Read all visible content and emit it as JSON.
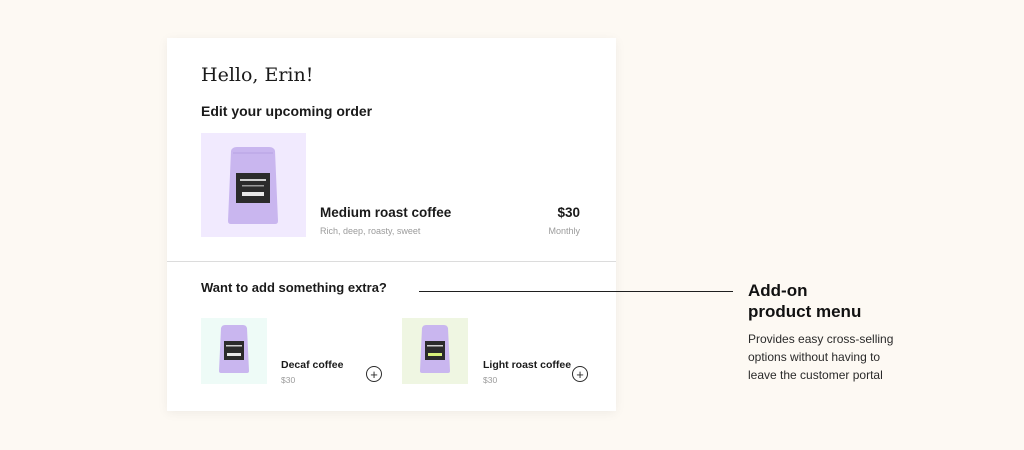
{
  "greeting": "Hello, Erin!",
  "subtitle": "Edit your upcoming order",
  "order_item": {
    "name": "Medium roast coffee",
    "description": "Rich, deep, roasty, sweet",
    "price": "$30",
    "frequency": "Monthly",
    "image_icon": "coffee-bag-icon",
    "thumb_bg": "#f1eafe"
  },
  "addons": {
    "title": "Want to add something extra?",
    "items": [
      {
        "name": "Decaf coffee",
        "price": "$30",
        "add_icon": "plus-circle-icon",
        "thumb_bg": "#eefbf7",
        "label_accent": "#e8e8e8"
      },
      {
        "name": "Light roast coffee",
        "price": "$30",
        "add_icon": "plus-circle-icon",
        "thumb_bg": "#eff6e2",
        "label_accent": "#d8f07a"
      }
    ]
  },
  "callout": {
    "title_line1": "Add-on",
    "title_line2": "product menu",
    "desc_line1": "Provides easy cross-selling",
    "desc_line2": "options without having to",
    "desc_line3": "leave the customer portal"
  },
  "colors": {
    "page_bg": "#fdf9f3",
    "bag_color": "#c9b6ef",
    "label_dark": "#2b2b2b"
  }
}
